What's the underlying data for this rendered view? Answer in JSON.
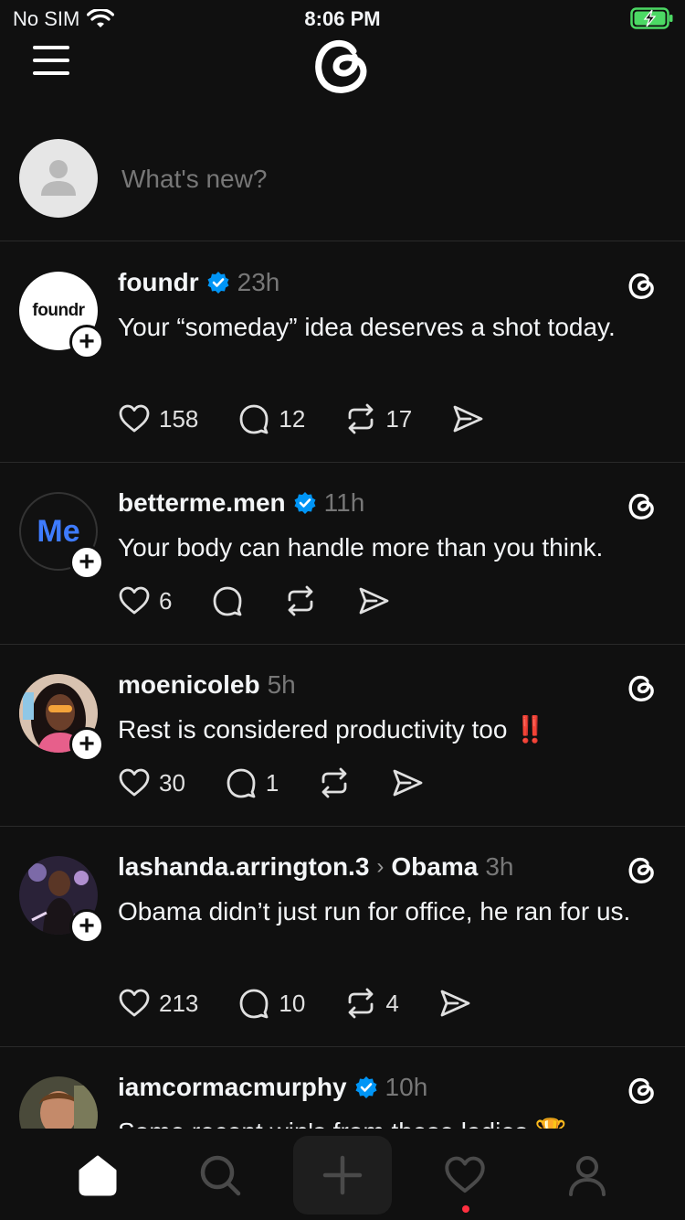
{
  "status_bar": {
    "carrier": "No SIM",
    "time": "8:06 PM"
  },
  "composer": {
    "placeholder": "What's new?"
  },
  "posts": [
    {
      "username": "foundr",
      "verified": true,
      "time": "23h",
      "avatar_text": "foundr",
      "body": "Your “someday” idea deserves a shot today.",
      "likes": "158",
      "replies": "12",
      "reposts": "17"
    },
    {
      "username": "betterme.men",
      "verified": true,
      "time": "11h",
      "avatar_text": "Me",
      "body": "Your body can handle more than you think.",
      "likes": "6",
      "replies": "",
      "reposts": ""
    },
    {
      "username": "moenicoleb",
      "verified": false,
      "time": "5h",
      "body": "Rest is considered productivity too",
      "body_emoji": "‼️",
      "likes": "30",
      "replies": "1",
      "reposts": ""
    },
    {
      "username": "lashanda.arrington.3",
      "verified": false,
      "topic": "Obama",
      "time": "3h",
      "body": "Obama didn’t just run for office, he ran for us.",
      "likes": "213",
      "replies": "10",
      "reposts": "4"
    },
    {
      "username": "iamcormacmurphy",
      "verified": true,
      "time": "10h",
      "body": "Some recent win's from these ladies 🏆"
    }
  ],
  "colors": {
    "background": "#101010",
    "verified": "#0095f6",
    "notification": "#ff3040"
  }
}
